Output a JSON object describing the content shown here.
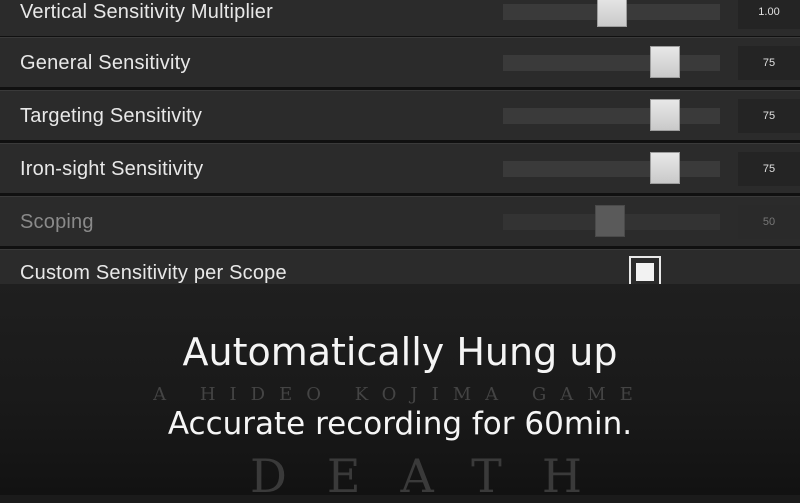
{
  "settings": {
    "rows": [
      {
        "label": "Vertical Sensitivity Multiplier",
        "value": "1.00",
        "slider_fraction": 0.5,
        "disabled": false
      },
      {
        "label": "General Sensitivity",
        "value": "75",
        "slider_fraction": 0.75,
        "disabled": false
      },
      {
        "label": "Targeting Sensitivity",
        "value": "75",
        "slider_fraction": 0.75,
        "disabled": false
      },
      {
        "label": "Iron-sight Sensitivity",
        "value": "75",
        "slider_fraction": 0.75,
        "disabled": false
      },
      {
        "label": "Scoping",
        "value": "50",
        "slider_fraction": 0.5,
        "disabled": true
      }
    ],
    "custom_scope": {
      "label": "Custom Sensitivity per Scope",
      "checked": true
    }
  },
  "overlay": {
    "caption_line1": "Automatically Hung up",
    "caption_line2": "Accurate recording for 60min.",
    "background_tagline": "A HIDEO KOJIMA GAME",
    "background_logo": "DEATH"
  }
}
